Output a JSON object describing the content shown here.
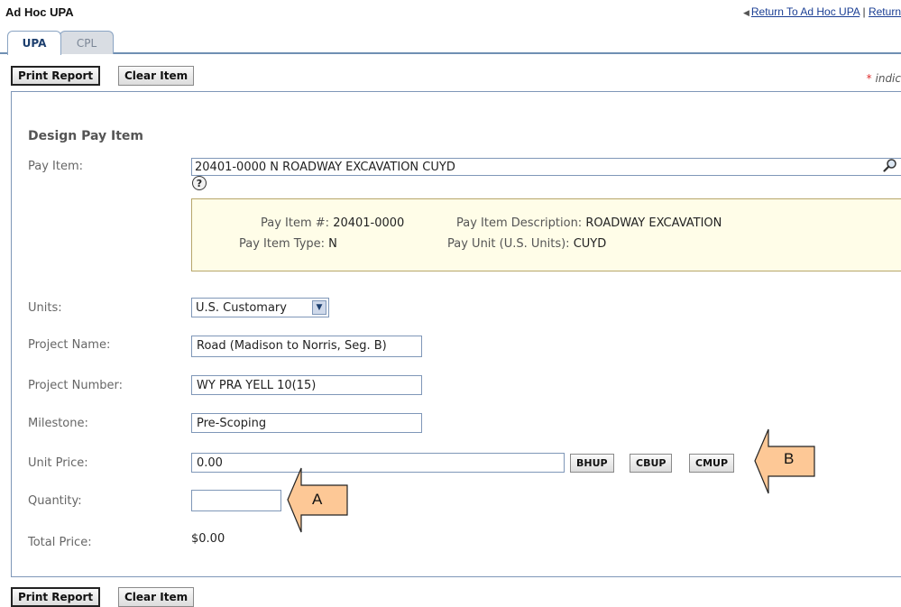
{
  "header": {
    "title": "Ad Hoc UPA",
    "link_return_adhoc": "Return To Ad Hoc UPA",
    "separator": "|",
    "link_return_more": "Return"
  },
  "tabs": [
    {
      "label": "UPA",
      "active": true
    },
    {
      "label": "CPL",
      "active": false
    }
  ],
  "toolbar": {
    "print_label": "Print Report",
    "clear_label": "Clear Item",
    "required_star": "*",
    "required_text": "indic"
  },
  "form": {
    "section_title": "Design Pay Item",
    "pay_item": {
      "label": "Pay Item:",
      "value": "20401-0000 N ROADWAY EXCAVATION CUYD"
    },
    "help_glyph": "?",
    "info": {
      "num_label": "Pay Item #:",
      "num_value": "20401-0000",
      "desc_label": "Pay Item Description:",
      "desc_value": "ROADWAY EXCAVATION",
      "type_label": "Pay Item Type:",
      "type_value": "N",
      "unit_label": "Pay Unit (U.S. Units):",
      "unit_value": "CUYD"
    },
    "units": {
      "label": "Units:",
      "value": "U.S. Customary"
    },
    "project_name": {
      "label": "Project Name:",
      "value": "Road (Madison to Norris, Seg. B)"
    },
    "project_number": {
      "label": "Project Number:",
      "value": "WY PRA YELL 10(15)"
    },
    "milestone": {
      "label": "Milestone:",
      "value": "Pre-Scoping"
    },
    "unit_price": {
      "label": "Unit Price:",
      "value": "0.00"
    },
    "price_buttons": {
      "bhup": "BHUP",
      "cbup": "CBUP",
      "cmup": "CMUP"
    },
    "quantity": {
      "label": "Quantity:",
      "value": ""
    },
    "total_price": {
      "label": "Total Price:",
      "value": "$0.00"
    }
  },
  "callouts": {
    "a": "A",
    "b": "B"
  },
  "colors": {
    "accent": "#1d3f6e",
    "border": "#7f97b8",
    "callout": "#fdc896",
    "info_bg": "#fffde8"
  }
}
